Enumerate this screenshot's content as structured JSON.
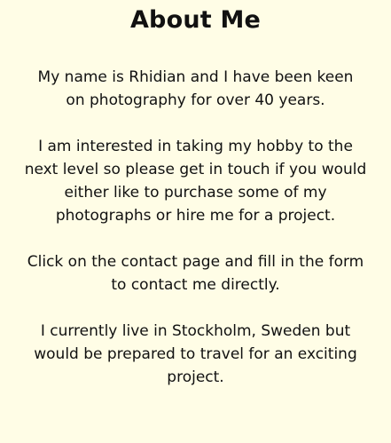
{
  "page_title": "About Me",
  "paragraphs": [
    {
      "lines": [
        "My name is  Rhidian and  I have been keen",
        "on photography for over 40 years."
      ]
    },
    {
      "lines": [
        "I am interested in taking my hobby to the",
        "next level so please get in touch if you would",
        "either like to purchase some of my",
        "photographs or hire me for a project."
      ]
    },
    {
      "lines": [
        "Click on the contact page and fill in the form",
        "to contact me directly."
      ]
    },
    {
      "lines": [
        "I currently live in Stockholm, Sweden but",
        "would be prepared to travel for an exciting",
        "project."
      ]
    }
  ],
  "colors": {
    "background": "#fffde6",
    "text": "#111111"
  }
}
